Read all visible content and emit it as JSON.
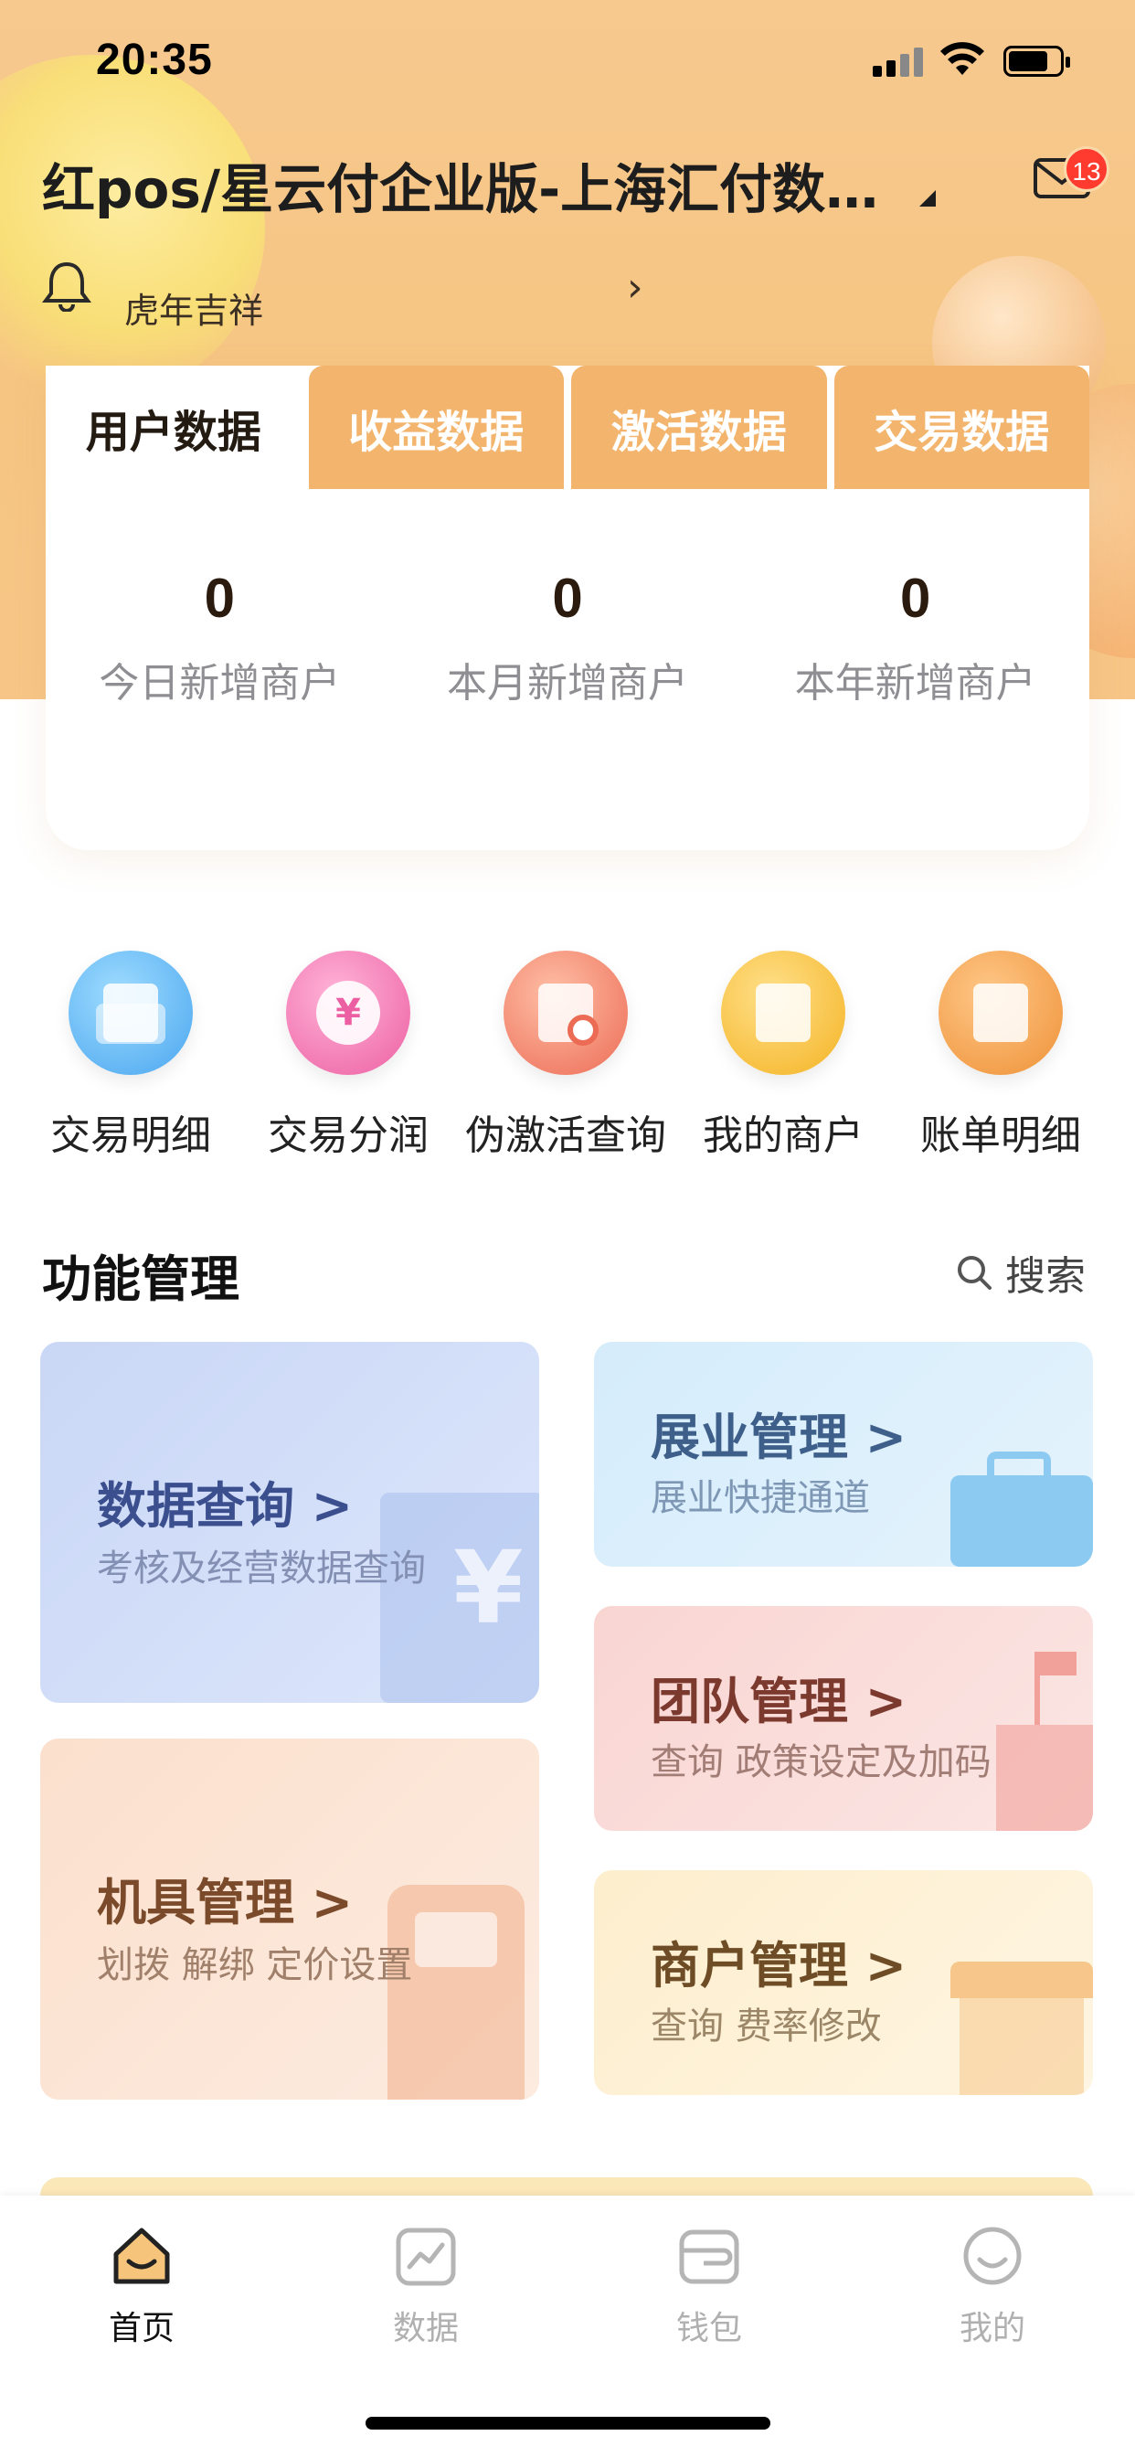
{
  "status_bar": {
    "time": "20:35"
  },
  "header": {
    "title": "红pos/星云付企业版-上海汇付数…",
    "mail_badge": "13",
    "notice_text": "虎年吉祥"
  },
  "stats_card": {
    "tabs": [
      {
        "label": "用户数据",
        "active": true
      },
      {
        "label": "收益数据",
        "active": false
      },
      {
        "label": "激活数据",
        "active": false
      },
      {
        "label": "交易数据",
        "active": false
      }
    ],
    "stats": [
      {
        "value": "0",
        "label": "今日新增商户"
      },
      {
        "value": "0",
        "label": "本月新增商户"
      },
      {
        "value": "0",
        "label": "本年新增商户"
      }
    ]
  },
  "quick_actions": [
    {
      "label": "交易明细",
      "icon": "folder-icon",
      "color": "#5cb6f2"
    },
    {
      "label": "交易分润",
      "icon": "yuan-circle-icon",
      "color": "#f07ab0"
    },
    {
      "label": "伪激活查询",
      "icon": "shop-search-icon",
      "color": "#f28a72"
    },
    {
      "label": "我的商户",
      "icon": "store-icon",
      "color": "#f6c042"
    },
    {
      "label": "账单明细",
      "icon": "bill-icon",
      "color": "#f4a350"
    }
  ],
  "function_section": {
    "title": "功能管理",
    "search_label": "搜索"
  },
  "tiles": {
    "data_query": {
      "title": "数据查询 >",
      "subtitle": "考核及经营数据查询"
    },
    "expansion": {
      "title": "展业管理 >",
      "subtitle": "展业快捷通道"
    },
    "team": {
      "title": "团队管理 >",
      "subtitle": "查询 政策设定及加码"
    },
    "machine": {
      "title": "机具管理 >",
      "subtitle": "划拨 解绑 定价设置"
    },
    "merchant": {
      "title": "商户管理 >",
      "subtitle": "查询 费率修改"
    }
  },
  "tabbar": {
    "items": [
      {
        "label": "首页",
        "icon": "home-icon",
        "active": true
      },
      {
        "label": "数据",
        "icon": "chart-icon",
        "active": false
      },
      {
        "label": "钱包",
        "icon": "wallet-icon",
        "active": false
      },
      {
        "label": "我的",
        "icon": "smiley-icon",
        "active": false
      }
    ]
  },
  "colors": {
    "accent_orange": "#f3b56d",
    "hero_background": "#f7c98f",
    "badge_red": "#ff3b30"
  }
}
